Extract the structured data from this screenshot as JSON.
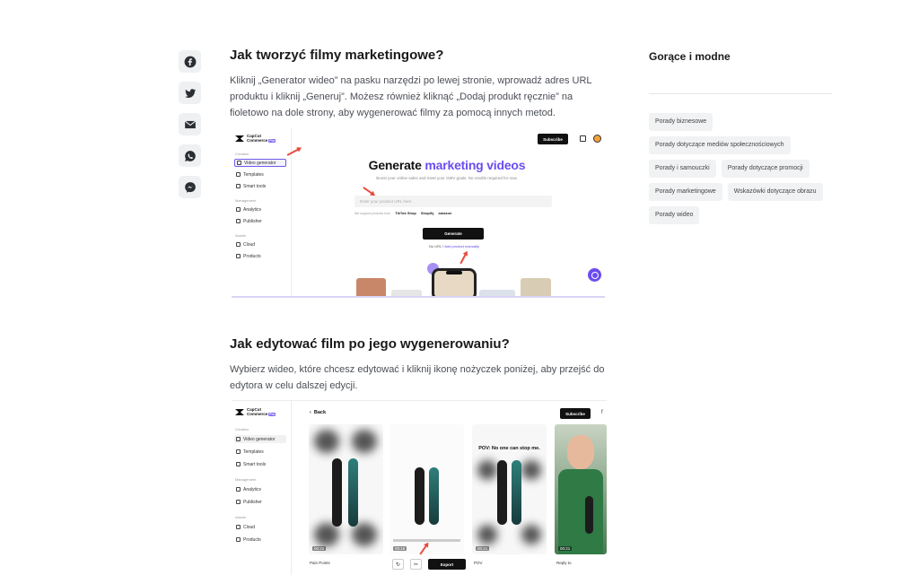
{
  "share": [
    "facebook-icon",
    "twitter-icon",
    "email-icon",
    "whatsapp-icon",
    "messenger-icon"
  ],
  "section1": {
    "title": "Jak tworzyć filmy marketingowe?",
    "text": "Kliknij „Generator wideo” na pasku narzędzi po lewej stronie, wprowadź adres URL produktu i kliknij „Generuj”. Możesz również kliknąć „Dodaj produkt ręcznie” na fioletowo na dole strony, aby wygenerować filmy za pomocą innych metod."
  },
  "section2": {
    "title": "Jak edytować film po jego wygenerowaniu?",
    "text": "Wybierz wideo, które chcesz edytować i kliknij ikonę nożyczek poniżej, aby przejść do edytora w celu dalszej edycji."
  },
  "app": {
    "brand_line1": "CapCut",
    "brand_line2": "Commerce",
    "brand_tag": "Pro",
    "creation_label": "Creation",
    "management_label": "Management",
    "assets_label": "Assets",
    "video_generator": "Video generator",
    "templates": "Templates",
    "smart_tools": "Smart tools",
    "analytics": "Analytics",
    "publisher": "Publisher",
    "cloud": "Cloud",
    "products": "Products",
    "subscribe": "Subscribe"
  },
  "shot1": {
    "heading_a": "Generate ",
    "heading_b": "marketing videos",
    "subheading": "Boost your online sales and meet your GMV goals. No credits required for now.",
    "input_placeholder": "Enter your product URL here",
    "support_label": "We support products from",
    "support_logos": [
      "TikTok Shop",
      "Shopify",
      "amazon"
    ],
    "generate": "Generate",
    "no_url": "No URL? ",
    "add_manually": "Add product manually"
  },
  "shot2": {
    "back": "Back",
    "more": "f",
    "card_times": [
      "00:22",
      "00:16",
      "00:21",
      "00:21"
    ],
    "card_caption_2": "POV: No one can stop me.",
    "card_labels": [
      "Pain Points",
      "POV",
      "Reply to"
    ],
    "export": "Export"
  },
  "sidebar": {
    "title": "Gorące i modne",
    "tags": [
      "Porady biznesowe",
      "Porady dotyczące mediów społecznościowych",
      "Porady i samouczki",
      "Porady dotyczące promocji",
      "Porady marketingowe",
      "Wskazówki dotyczące obrazu",
      "Porady wideo"
    ]
  },
  "colors": {
    "accent": "#6c4cf1",
    "arrow": "#e74c3c"
  }
}
